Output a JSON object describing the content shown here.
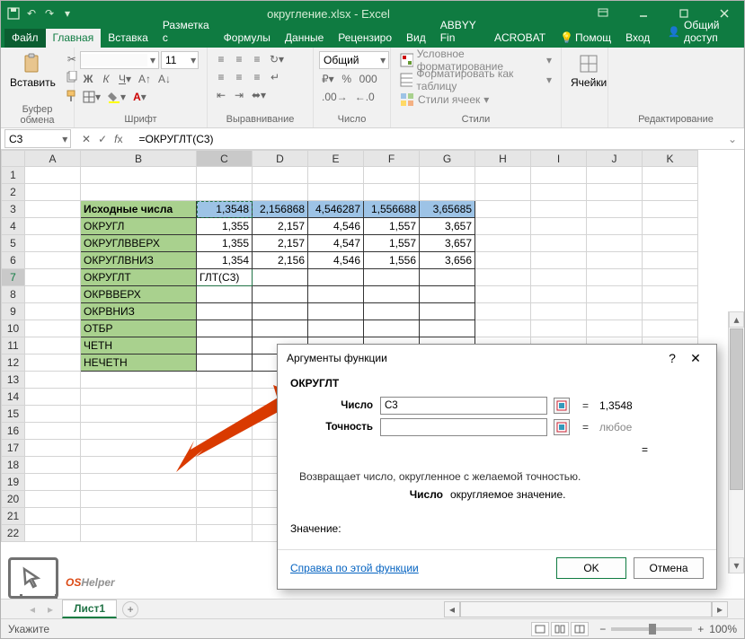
{
  "titlebar": {
    "title": "округление.xlsx - Excel"
  },
  "tabs": {
    "file": "Файл",
    "items": [
      "Главная",
      "Вставка",
      "Разметка с",
      "Формулы",
      "Данные",
      "Рецензиро",
      "Вид",
      "ABBYY Fin",
      "ACROBAT"
    ],
    "help": "Помощ",
    "signin": "Вход",
    "share": "Общий доступ"
  },
  "ribbon": {
    "clipboard": {
      "paste": "Вставить",
      "label": "Буфер обмена"
    },
    "font": {
      "label": "Шрифт",
      "size": "11"
    },
    "align": {
      "label": "Выравнивание"
    },
    "number": {
      "format": "Общий",
      "label": "Число"
    },
    "styles": {
      "conditional": "Условное форматирование",
      "table": "Форматировать как таблицу",
      "cellstyles": "Стили ячеек",
      "label": "Стили"
    },
    "cells": {
      "cells": "Ячейки"
    },
    "editing": {
      "label": "Редактирование"
    }
  },
  "formula": {
    "namebox": "C3",
    "bar": "=ОКРУГЛТ(C3)"
  },
  "sheet": {
    "cols": [
      "A",
      "B",
      "C",
      "D",
      "E",
      "F",
      "G",
      "H",
      "I",
      "J",
      "K"
    ],
    "rows_count": 22,
    "head_label": "Исходные числа",
    "data_header": [
      "1,3548",
      "2,156868",
      "4,546287",
      "1,556688",
      "3,65685"
    ],
    "rows": [
      {
        "label": "ОКРУГЛ",
        "vals": [
          "1,355",
          "2,157",
          "4,546",
          "1,557",
          "3,657"
        ]
      },
      {
        "label": "ОКРУГЛВВЕРХ",
        "vals": [
          "1,355",
          "2,157",
          "4,547",
          "1,557",
          "3,657"
        ]
      },
      {
        "label": "ОКРУГЛВНИЗ",
        "vals": [
          "1,354",
          "2,156",
          "4,546",
          "1,556",
          "3,656"
        ]
      },
      {
        "label": "ОКРУГЛТ",
        "vals": [
          "ГЛТ(C3)",
          "",
          "",
          "",
          ""
        ]
      },
      {
        "label": "ОКРВВЕРХ",
        "vals": [
          "",
          "",
          "",
          "",
          ""
        ]
      },
      {
        "label": "ОКРВНИЗ",
        "vals": [
          "",
          "",
          "",
          "",
          ""
        ]
      },
      {
        "label": "ОТБР",
        "vals": [
          "",
          "",
          "",
          "",
          ""
        ]
      },
      {
        "label": "ЧЕТН",
        "vals": [
          "",
          "",
          "",
          "",
          ""
        ]
      },
      {
        "label": "НЕЧЕТН",
        "vals": [
          "",
          "",
          "",
          "",
          ""
        ]
      }
    ]
  },
  "dialog": {
    "title": "Аргументы функции",
    "fn": "ОКРУГЛТ",
    "args": {
      "number_label": "Число",
      "number_value": "C3",
      "number_result": "1,3548",
      "precision_label": "Точность",
      "precision_value": "",
      "precision_result": "любое"
    },
    "eq_empty": "=",
    "desc": "Возвращает число, округленное с желаемой точностью.",
    "argdesc_label": "Число",
    "argdesc": "округляемое значение.",
    "value_label": "Значение:",
    "help": "Справка по этой функции",
    "ok": "OK",
    "cancel": "Отмена"
  },
  "sheettab": {
    "name": "Лист1"
  },
  "statusbar": {
    "mode": "Укажите",
    "zoom": "100%"
  },
  "logo": {
    "os": "OS",
    "helper": "Helper"
  }
}
